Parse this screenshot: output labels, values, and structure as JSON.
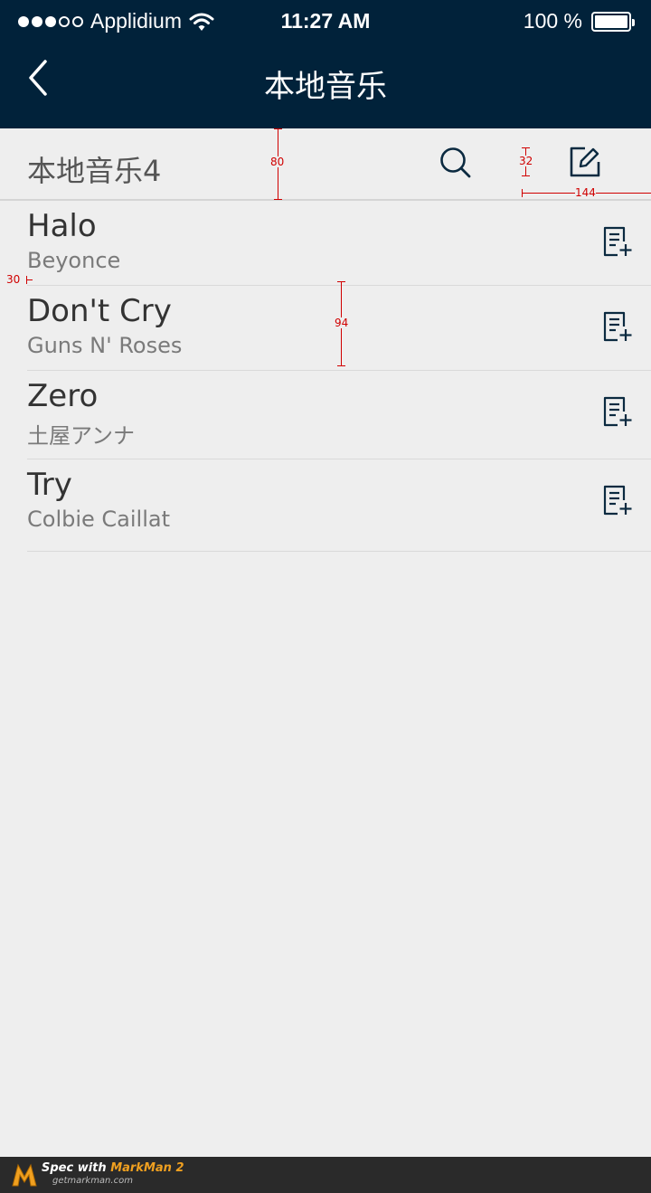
{
  "status_bar": {
    "carrier": "Applidium",
    "time": "11:27 AM",
    "battery": "100 %",
    "signal_bars_filled": 3,
    "signal_bars_total": 5,
    "battery_level": 1.0
  },
  "nav": {
    "title": "本地音乐",
    "back_icon": "chevron-left-icon"
  },
  "subheader": {
    "title": "本地音乐4",
    "search_icon": "search-icon",
    "edit_icon": "edit-icon"
  },
  "songs": [
    {
      "title": "Halo",
      "artist": "Beyonce",
      "action_icon": "add-to-playlist-icon"
    },
    {
      "title": "Don't Cry",
      "artist": "Guns N' Roses",
      "action_icon": "add-to-playlist-icon"
    },
    {
      "title": "Zero",
      "artist": "土屋アンナ",
      "action_icon": "add-to-playlist-icon"
    },
    {
      "title": "Try",
      "artist": "Colbie Caillat",
      "action_icon": "add-to-playlist-icon"
    }
  ],
  "annotations": {
    "header_height": "80",
    "icon_size": "32",
    "icon_spacing": "144",
    "left_margin": "30",
    "row_height": "94"
  },
  "footer": {
    "spec_prefix": "Spec with ",
    "spec_brand": "MarkMan 2",
    "spec_url": "getmarkman.com"
  },
  "colors": {
    "nav_background": "#01223a",
    "page_background": "#eeeeee",
    "icon_color": "#0b2a40",
    "annotation_color": "#d00000"
  }
}
